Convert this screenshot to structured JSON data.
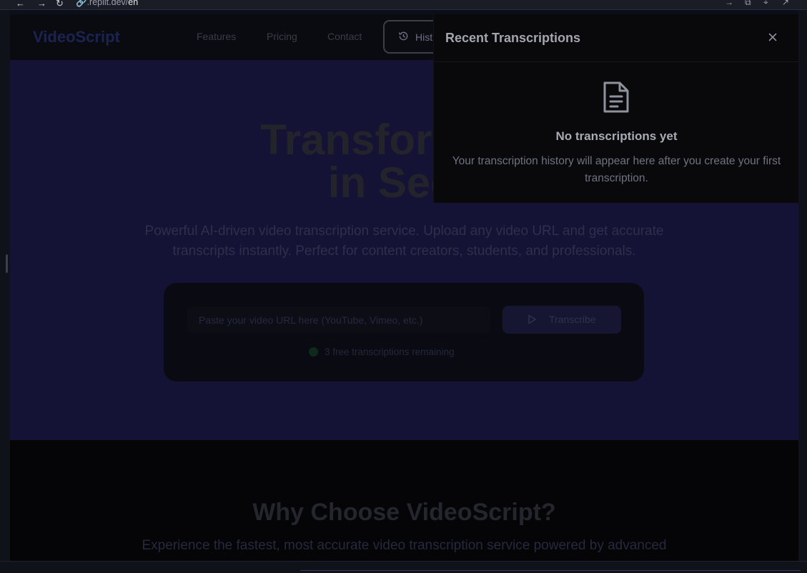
{
  "browser": {
    "url_prefix": ".replit.dev/",
    "url_path": "en",
    "back_icon": "arrow-left-icon",
    "forward_icon": "arrow-right-icon",
    "reload_icon": "reload-icon"
  },
  "header": {
    "logo": "VideoScript",
    "nav": [
      "Features",
      "Pricing",
      "Contact"
    ],
    "history_label": "Hist"
  },
  "hero": {
    "title_line1": "Transform Vid",
    "title_line2": "in Seco",
    "subtitle": "Powerful AI-driven video transcription service. Upload any video URL and get accurate transcripts instantly. Perfect for content creators, students, and professionals.",
    "input_placeholder": "Paste your video URL here (YouTube, Vimeo, etc.)",
    "transcribe_label": "Transcribe",
    "remaining_text": "3 free transcriptions remaining"
  },
  "features": {
    "title": "Why Choose VideoScript?",
    "subtitle": "Experience the fastest, most accurate video transcription service powered by advanced"
  },
  "drawer": {
    "title": "Recent Transcriptions",
    "empty_title": "No transcriptions yet",
    "empty_desc": "Your transcription history will appear here after you create your first transcription."
  },
  "colors": {
    "hero_bg": "#141335",
    "drawer_bg": "#09090c",
    "accent": "#171632"
  }
}
